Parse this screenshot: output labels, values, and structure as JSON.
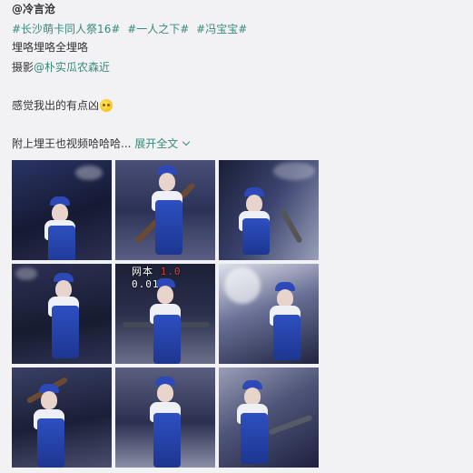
{
  "post": {
    "author": "@冷言沧",
    "tags": [
      "#长沙萌卡同人祭16#",
      "#一人之下#",
      "#冯宝宝#"
    ],
    "line1": "埋咯埋咯全埋咯",
    "photo_prefix": "摄影",
    "photo_mention": "@朴实瓜农森近",
    "line3": "感觉我出的有点凶",
    "emoji": "laugh-cry-emoji",
    "line4_text": "附上埋王也视频哈哈哈...",
    "expand_label": "展开全文"
  },
  "images": {
    "count": 9,
    "watermark_left": "网本",
    "watermark_red": "1.0",
    "watermark_right": "0.01"
  },
  "colors": {
    "link": "#3a8a7b",
    "background": "#f2f2f5",
    "overall_blue": "#2d4fc0"
  }
}
